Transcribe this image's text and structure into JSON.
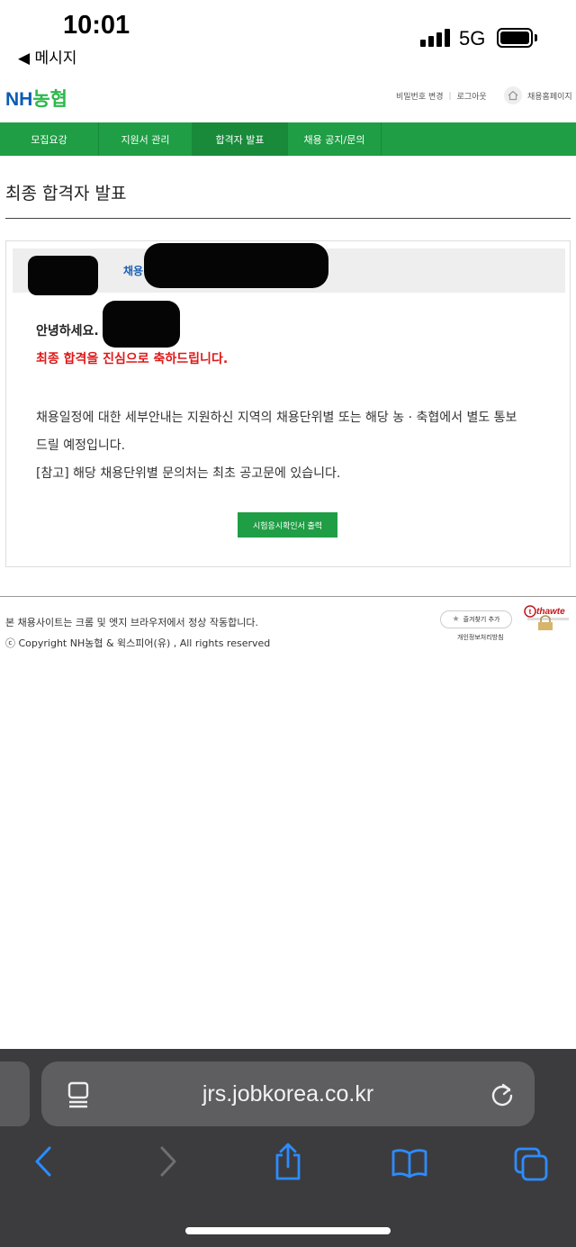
{
  "status_bar": {
    "time": "10:01",
    "back_app": "◀ 메시지",
    "network": "5G"
  },
  "header": {
    "logo_nh": "NH",
    "logo_kr": "농협",
    "change_password": "비밀번호 변경",
    "logout": "로그아웃",
    "home_label": "채용홈페이지"
  },
  "nav": {
    "tabs": [
      {
        "label": "모집요강"
      },
      {
        "label": "지원서 관리"
      },
      {
        "label": "합격자 발표"
      },
      {
        "label": "채용 공지/문의"
      }
    ]
  },
  "page": {
    "title": "최종 합격자 발표"
  },
  "result": {
    "unit_label": "채용단위",
    "greeting": "안녕하세요.",
    "congrats": "최종 합격을 진심으로 축하드립니다.",
    "line1": "채용일정에 대한 세부안내는 지원하신 지역의 채용단위별 또는 해당 농 · 축협에서 별도 통보",
    "line2": "드릴 예정입니다.",
    "line3": "[참고] 해당 채용단위별 문의처는 최초 공고문에 있습니다.",
    "print_button": "시험응시확인서 출력"
  },
  "footer": {
    "notice": "본 채용사이트는 크롬 및 엣지 브라우저에서 정상 작동합니다.",
    "copyright": "ⓒ Copyright NH농협 & 윅스피어(유) , All rights reserved",
    "bookmark": "즐겨찾기 추가",
    "privacy": "개인정보처리방침",
    "thawte": "thawte"
  },
  "browser": {
    "url": "jrs.jobkorea.co.kr"
  },
  "colors": {
    "nav_green": "#1f9e45",
    "congrats_red": "#e01818",
    "label_blue": "#1a5fb4"
  },
  "icons": [
    "signal-icon",
    "battery-icon",
    "home-icon",
    "star-icon",
    "reader-icon",
    "reload-icon",
    "back-icon",
    "forward-icon",
    "share-icon",
    "bookmarks-icon",
    "tabs-icon"
  ]
}
